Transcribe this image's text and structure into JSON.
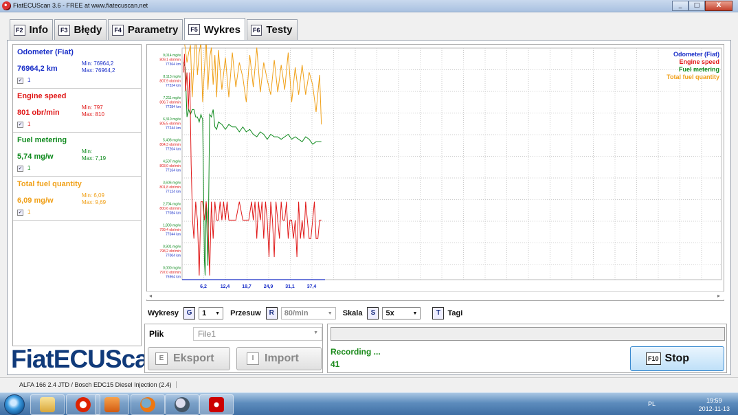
{
  "window": {
    "title": "FiatECUScan 3.6 - FREE at www.fiatecuscan.net",
    "buttons": [
      "_",
      "□",
      "X"
    ]
  },
  "tabs": [
    {
      "key": "F2",
      "label": "Info"
    },
    {
      "key": "F3",
      "label": "Błędy"
    },
    {
      "key": "F4",
      "label": "Parametry"
    },
    {
      "key": "F5",
      "label": "Wykres"
    },
    {
      "key": "F6",
      "label": "Testy"
    }
  ],
  "sensors": [
    {
      "name": "Odometer (Fiat)",
      "value": "76964,2 km",
      "min": "Min: 76964,2",
      "max": "Max: 76964,2",
      "chk": "1",
      "color": "#1a2fc8"
    },
    {
      "name": "Engine speed",
      "value": "801 obr/min",
      "min": "Min: 797",
      "max": "Max: 810",
      "chk": "1",
      "color": "#e01818"
    },
    {
      "name": "Fuel metering",
      "value": "5,74 mg/w",
      "min": "Min:",
      "max": "Max: 7,19",
      "chk": "1",
      "color": "#0f8a1e"
    },
    {
      "name": "Total fuel quantity",
      "value": "6,09 mg/w",
      "min": "Min: 6,09",
      "max": "Max: 9,69",
      "chk": "1",
      "color": "#f0a018"
    }
  ],
  "logo": "FiatECUScan",
  "chart_data": {
    "type": "line",
    "x_ticks": [
      "6,2",
      "12,4",
      "18,7",
      "24,9",
      "31,1",
      "37,4"
    ],
    "y_tick_groups": [
      [
        "9,014 mg/w",
        "809,1 obr/min",
        "77364 km"
      ],
      [
        "8,113 mg/w",
        "807,9 obr/min",
        "77324 km"
      ],
      [
        "7,211 mg/w",
        "806,7 obr/min",
        "77284 km"
      ],
      [
        "6,310 mg/w",
        "805,5 obr/min",
        "77244 km"
      ],
      [
        "5,408 mg/w",
        "804,3 obr/min",
        "77204 km"
      ],
      [
        "4,507 mg/w",
        "803,0 obr/min",
        "77164 km"
      ],
      [
        "3,606 mg/w",
        "801,8 obr/min",
        "77124 km"
      ],
      [
        "2,704 mg/w",
        "800,6 obr/min",
        "77084 km"
      ],
      [
        "1,803 mg/w",
        "799,4 obr/min",
        "77044 km"
      ],
      [
        "0,901 mg/w",
        "798,2 obr/min",
        "77004 km"
      ],
      [
        "0,000 mg/w",
        "797,0 obr/min",
        "76964 km"
      ]
    ],
    "xlim": [
      0,
      40
    ],
    "legend_position": "top-right",
    "grid": true,
    "series": [
      {
        "name": "Odometer (Fiat)",
        "color": "#1a2fc8",
        "values": []
      },
      {
        "name": "Engine speed",
        "color": "#e01818",
        "x": [
          0,
          0.3,
          0.6,
          1.0,
          1.4,
          1.8,
          2.2,
          2.6,
          3.0,
          3.5,
          4.0,
          4.5,
          5.0,
          5.5,
          6.0,
          6.5,
          7.0,
          7.5,
          8.0,
          8.5,
          9.0,
          9.5,
          10.0,
          10.5,
          11.0,
          11.5,
          12.0,
          12.5,
          13.0,
          14.0,
          15.0,
          16.0,
          17.0,
          18.0,
          18.7,
          19.5,
          20.0,
          20.5,
          21.0,
          21.5,
          22.0,
          22.5,
          23.0,
          23.5,
          24.0,
          24.5,
          25.0,
          25.5,
          26.0,
          26.5,
          27.0,
          27.5,
          28.0,
          28.5,
          29.0,
          29.5,
          30.0,
          30.5,
          31.0,
          31.5,
          32.0,
          32.5,
          33.0,
          33.5,
          34.0,
          34.5,
          35.0,
          35.5,
          36.0,
          36.5,
          37.0,
          37.5,
          38.0,
          38.5,
          39.0,
          39.5
        ],
        "values": [
          808,
          809,
          807,
          808,
          806,
          808,
          803,
          800,
          799,
          801,
          800,
          797,
          801,
          801,
          800,
          801,
          800,
          797,
          801,
          799,
          801,
          800,
          800,
          801,
          800,
          801,
          800,
          801,
          800,
          800,
          800,
          801,
          800,
          800,
          800,
          801,
          800,
          801,
          799,
          801,
          800,
          801,
          799,
          801,
          800,
          798,
          801,
          800,
          798,
          801,
          800,
          799,
          801,
          800,
          800,
          801,
          799,
          800,
          800,
          799,
          800,
          798,
          801,
          799,
          800,
          799,
          801,
          800,
          799,
          799,
          800,
          801,
          799,
          799,
          800,
          800
        ]
      },
      {
        "name": "Fuel metering",
        "color": "#0f8a1e",
        "x": [
          0,
          0.5,
          1.0,
          1.5,
          2.0,
          2.5,
          3.0,
          3.5,
          4.0,
          4.5,
          5.0,
          5.5,
          6.0,
          6.2,
          6.5,
          7.0,
          7.5,
          8.0,
          8.5,
          9.0,
          9.5,
          10.0,
          11.0,
          12.0,
          13.0,
          14.0,
          15.0,
          16.0,
          17.0,
          18.0,
          19.0,
          20.0,
          21.0,
          22.0,
          23.0,
          24.0,
          25.0,
          26.0,
          27.0,
          28.0,
          29.0,
          30.0,
          31.0,
          32.0,
          33.0,
          34.0,
          35.0,
          36.0,
          37.0,
          38.0,
          39.0,
          39.5
        ],
        "values": [
          8.6,
          8.4,
          6.4,
          6.7,
          6.5,
          6.7,
          6.7,
          6.4,
          6.4,
          6.2,
          6.5,
          6.3,
          0.6,
          0.0,
          3.0,
          0.4,
          6.5,
          6.4,
          6.7,
          6.0,
          5.9,
          6.2,
          6.1,
          5.9,
          6.1,
          6.0,
          6.0,
          5.8,
          6.0,
          5.8,
          5.9,
          5.7,
          5.6,
          5.8,
          5.7,
          5.5,
          5.7,
          5.6,
          5.6,
          5.5,
          5.6,
          5.7,
          5.5,
          5.6,
          5.5,
          5.4,
          5.6,
          5.5,
          5.3,
          5.4,
          5.4,
          5.4
        ]
      },
      {
        "name": "Total fuel quantity",
        "color": "#f0a018",
        "x": [
          0,
          0.5,
          1.0,
          1.5,
          2.0,
          2.5,
          3.0,
          3.5,
          4.0,
          4.5,
          5.0,
          5.5,
          6.0,
          6.5,
          7.0,
          7.5,
          8.0,
          8.5,
          9.0,
          9.5,
          10.0,
          11.0,
          12.0,
          13.0,
          14.0,
          15.0,
          16.0,
          17.0,
          18.0,
          19.0,
          20.0,
          21.0,
          22.0,
          23.0,
          24.0,
          25.0,
          26.0,
          27.0,
          28.0,
          29.0,
          30.0,
          31.0,
          32.0,
          33.0,
          34.0,
          35.0,
          36.0,
          37.0,
          38.0,
          39.0,
          39.5
        ],
        "values": [
          9.6,
          9.2,
          8.6,
          9.0,
          9.3,
          7.2,
          8.5,
          9.7,
          8.1,
          9.0,
          9.4,
          7.0,
          8.3,
          9.6,
          7.5,
          8.8,
          9.2,
          7.7,
          8.9,
          7.2,
          9.1,
          7.5,
          8.8,
          7.2,
          9.0,
          7.6,
          8.6,
          8.0,
          7.0,
          8.9,
          7.6,
          9.2,
          7.4,
          8.6,
          7.9,
          7.3,
          8.7,
          7.4,
          8.5,
          7.5,
          9.0,
          7.0,
          8.4,
          7.3,
          8.5,
          7.3,
          8.2,
          7.7,
          6.6,
          8.1,
          6.1
        ]
      }
    ]
  },
  "controls": {
    "wykresy_label": "Wykresy",
    "wykresy_key": "G",
    "wykresy_value": "1",
    "przesuw_label": "Przesuw",
    "przesuw_key": "R",
    "przesuw_value": "80/min",
    "skala_label": "Skala",
    "skala_key": "S",
    "skala_value": "5x",
    "tagi_key": "T",
    "tagi_label": "Tagi"
  },
  "file": {
    "label": "Plik",
    "value": "File1"
  },
  "buttons": {
    "export_key": "E",
    "export_label": "Eksport",
    "import_key": "I",
    "import_label": "Import",
    "stop_key": "F10",
    "stop_label": "Stop"
  },
  "status": {
    "recording": "Recording ...",
    "count": "41"
  },
  "app_status": "ALFA 166 2.4 JTD / Bosch EDC15 Diesel Injection (2.4)",
  "taskbar": {
    "tray_lang": "PL",
    "time": "19:59",
    "date": "2012-11-13"
  }
}
